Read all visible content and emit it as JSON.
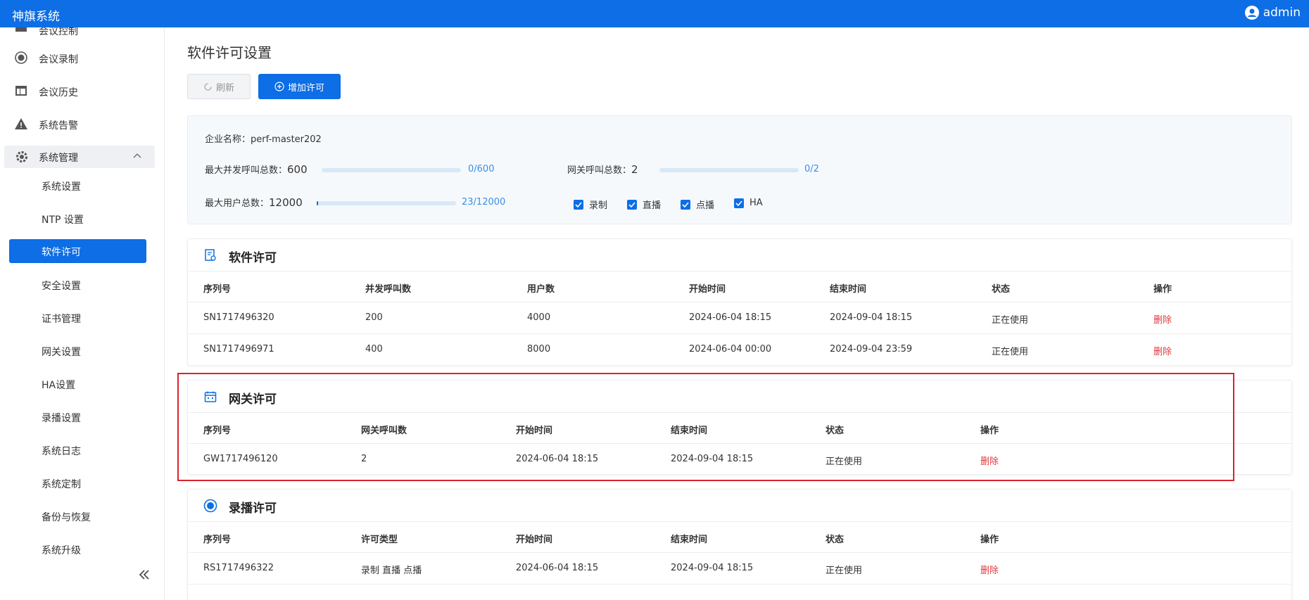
{
  "app": {
    "title": "神旗系统",
    "user": "admin",
    "accent": "#0d6ee5",
    "danger": "#e0393e"
  },
  "sidebar": {
    "partial_item": "会议控制",
    "items": [
      {
        "label": "会议录制",
        "icon": "record-icon"
      },
      {
        "label": "会议历史",
        "icon": "table-icon"
      },
      {
        "label": "系统告警",
        "icon": "warning-icon"
      }
    ],
    "group": {
      "label": "系统管理",
      "icon": "gear-icon"
    },
    "sub_items": [
      "系统设置",
      "NTP 设置",
      "软件许可",
      "安全设置",
      "证书管理",
      "网关设置",
      "HA设置",
      "录播设置",
      "系统日志",
      "系统定制",
      "备份与恢复",
      "系统升级"
    ],
    "active_sub": "软件许可"
  },
  "page": {
    "title": "软件许可设置",
    "refresh_label": "刷新",
    "add_label": "增加许可"
  },
  "info": {
    "company_label": "企业名称：",
    "company": "perf-master202",
    "max_calls_label": "最大并发呼叫总数：",
    "max_calls": "600",
    "max_calls_usage": "0/600",
    "max_calls_ratio": 0,
    "gateway_label": "网关呼叫总数：",
    "gateway_total": "2",
    "gateway_usage": "0/2",
    "gateway_ratio": 0,
    "max_users_label": "最大用户总数：",
    "max_users": "12000",
    "max_users_usage": "23/12000",
    "max_users_ratio": 0.0019,
    "features": [
      "录制",
      "直播",
      "点播",
      "HA"
    ]
  },
  "software_license": {
    "title": "软件许可",
    "columns": [
      "序列号",
      "并发呼叫数",
      "用户数",
      "开始时间",
      "结束时间",
      "状态",
      "操作"
    ],
    "rows": [
      [
        "SN1717496320",
        "200",
        "4000",
        "2024-06-04 18:15",
        "2024-09-04 18:15",
        "正在使用",
        "删除"
      ],
      [
        "SN1717496971",
        "400",
        "8000",
        "2024-06-04 00:00",
        "2024-09-04 23:59",
        "正在使用",
        "删除"
      ]
    ]
  },
  "gateway_license": {
    "title": "网关许可",
    "columns": [
      "序列号",
      "网关呼叫数",
      "开始时间",
      "结束时间",
      "状态",
      "操作"
    ],
    "rows": [
      [
        "GW1717496120",
        "2",
        "2024-06-04 18:15",
        "2024-09-04 18:15",
        "正在使用",
        "删除"
      ]
    ]
  },
  "recording_license": {
    "title": "录播许可",
    "columns": [
      "序列号",
      "许可类型",
      "开始时间",
      "结束时间",
      "状态",
      "操作"
    ],
    "rows": [
      [
        "RS1717496322",
        "录制 直播 点播",
        "2024-06-04 18:15",
        "2024-09-04 18:15",
        "正在使用",
        "删除"
      ]
    ]
  }
}
